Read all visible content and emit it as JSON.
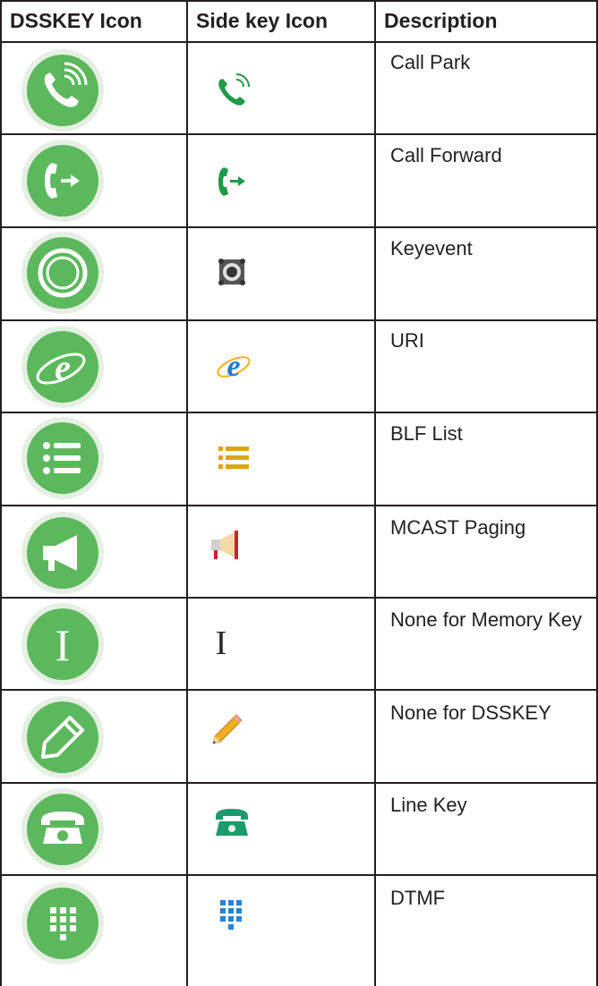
{
  "table": {
    "headers": {
      "dsskey": "DSSKEY Icon",
      "side": "Side key Icon",
      "description": "Description"
    },
    "rows": [
      {
        "description": "Call Park",
        "dsskey_icon": "call-park-icon",
        "side_icon": "call-park-icon"
      },
      {
        "description": "Call Forward",
        "dsskey_icon": "call-forward-icon",
        "side_icon": "call-forward-icon"
      },
      {
        "description": "Keyevent",
        "dsskey_icon": "keyevent-icon",
        "side_icon": "keyevent-icon"
      },
      {
        "description": "URI",
        "dsskey_icon": "uri-browser-icon",
        "side_icon": "uri-browser-icon"
      },
      {
        "description": "BLF List",
        "dsskey_icon": "blf-list-icon",
        "side_icon": "blf-list-icon"
      },
      {
        "description": "MCAST Paging",
        "dsskey_icon": "megaphone-icon",
        "side_icon": "megaphone-icon"
      },
      {
        "description": "None for Memory Key",
        "dsskey_icon": "text-cursor-icon",
        "side_icon": "text-cursor-icon"
      },
      {
        "description": "None for DSSKEY",
        "dsskey_icon": "pencil-icon",
        "side_icon": "pencil-icon"
      },
      {
        "description": "Line Key",
        "dsskey_icon": "desk-phone-icon",
        "side_icon": "desk-phone-icon"
      },
      {
        "description": "DTMF",
        "dsskey_icon": "dialpad-icon",
        "side_icon": "dialpad-icon"
      }
    ]
  },
  "colors": {
    "dsskey_green": "#5cb85c",
    "dsskey_ring": "#e6efe3",
    "side_green": "#1f9a47",
    "side_teal": "#1d9a6c",
    "rule": "#231f20"
  }
}
